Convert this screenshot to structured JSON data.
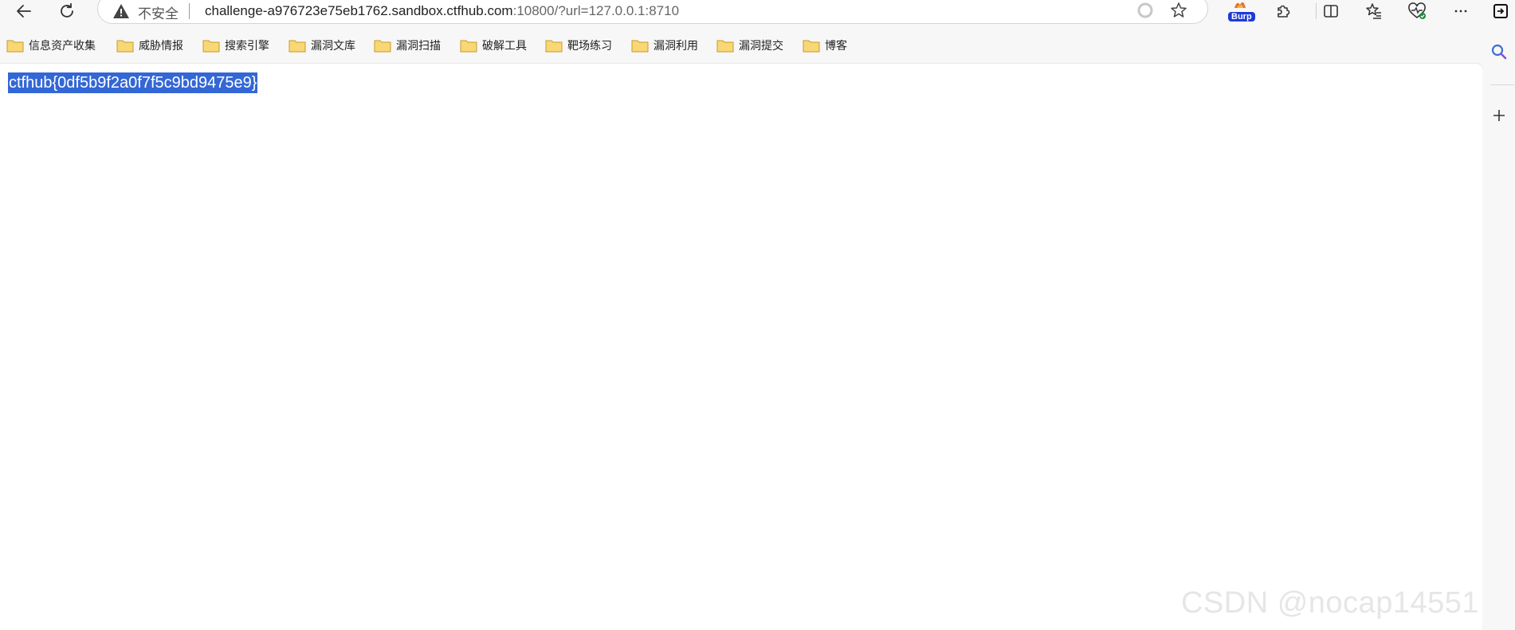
{
  "browser": {
    "address_bar": {
      "security_label": "不安全",
      "url_host": "challenge-a976723e75eb1762.sandbox.ctfhub.com",
      "url_rest": ":10800/?url=127.0.0.1:8710"
    },
    "extensions": {
      "burp_label": "Burp"
    },
    "bookmarks": [
      {
        "label": "信息资产收集"
      },
      {
        "label": "威胁情报"
      },
      {
        "label": "搜索引擎"
      },
      {
        "label": "漏洞文库"
      },
      {
        "label": "漏洞扫描"
      },
      {
        "label": "破解工具"
      },
      {
        "label": "靶场练习"
      },
      {
        "label": "漏洞利用"
      },
      {
        "label": "漏洞提交"
      },
      {
        "label": "博客"
      }
    ]
  },
  "page": {
    "selected_text": "ctfhub{0df5b9f2a0f7f5c9bd9475e9}",
    "watermark": "CSDN @nocap14551"
  },
  "colors": {
    "selection": "#3367d6",
    "burp_badge": "#1d3ad8",
    "folder_fill": "#f8d775",
    "folder_stroke": "#c89b2a"
  }
}
